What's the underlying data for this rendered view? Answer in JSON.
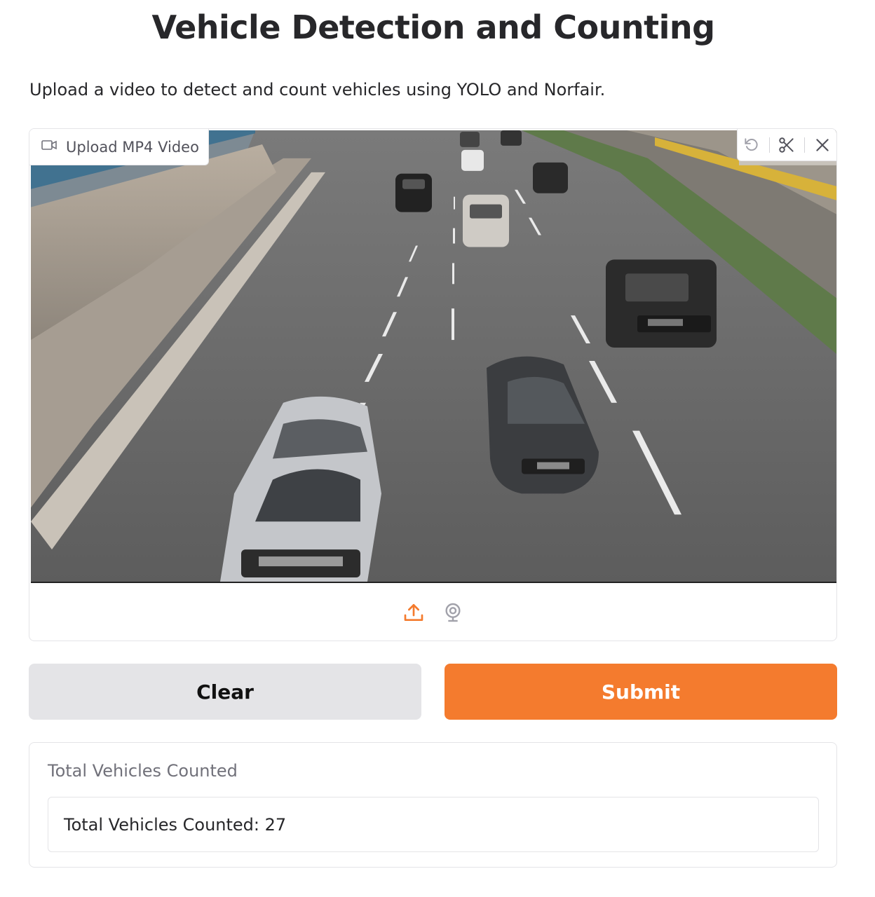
{
  "page": {
    "title": "Vehicle Detection and Counting",
    "description": "Upload a video to detect and count vehicles using YOLO and Norfair."
  },
  "video_input": {
    "label": "Upload MP4 Video",
    "icons": {
      "label": "video-camera-icon",
      "undo": "undo-icon",
      "trim": "scissors-icon",
      "clear": "close-icon",
      "upload": "upload-icon",
      "webcam": "webcam-icon"
    }
  },
  "buttons": {
    "clear": "Clear",
    "submit": "Submit"
  },
  "output": {
    "label": "Total Vehicles Counted",
    "value": "Total Vehicles Counted: 27"
  },
  "colors": {
    "accent": "#f47b2e",
    "secondary_button": "#e4e4e7",
    "border": "#e4e4e7"
  }
}
